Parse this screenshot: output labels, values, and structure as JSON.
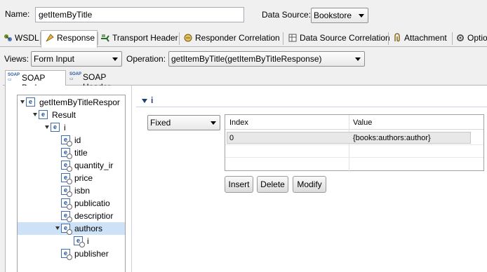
{
  "header": {
    "name_label": "Name:",
    "name_value": "getItemByTitle",
    "datasource_label": "Data Source:",
    "datasource_value": "Bookstore"
  },
  "tabs": [
    {
      "label": "WSDL",
      "icon": "wsdl-icon"
    },
    {
      "label": "Response",
      "icon": "response-icon",
      "active": true
    },
    {
      "label": "Transport Header",
      "icon": "transport-header-icon"
    },
    {
      "label": "Responder Correlation",
      "icon": "responder-correlation-icon"
    },
    {
      "label": "Data Source Correlation",
      "icon": "data-source-correlation-icon"
    },
    {
      "label": "Attachment",
      "icon": "attachment-icon"
    },
    {
      "label": "Optio",
      "icon": "options-icon"
    }
  ],
  "views": {
    "label": "Views:",
    "value": "Form Input",
    "operation_label": "Operation:",
    "operation_value": "getItemByTitle(getItemByTitleResponse)"
  },
  "subtabs": [
    {
      "label": "SOAP Body",
      "icon": "soap-icon",
      "active": true
    },
    {
      "label": "SOAP Header",
      "icon": "soap-icon"
    }
  ],
  "tree": [
    {
      "label": "getItemByTitleRespor",
      "level": 0,
      "expanded": true
    },
    {
      "label": "Result",
      "level": 1,
      "expanded": true
    },
    {
      "label": "i",
      "level": 2,
      "expanded": true
    },
    {
      "label": "id",
      "level": 3
    },
    {
      "label": "title",
      "level": 3
    },
    {
      "label": "quantity_ir",
      "level": 3
    },
    {
      "label": "price",
      "level": 3
    },
    {
      "label": "isbn",
      "level": 3
    },
    {
      "label": "publicatio",
      "level": 3
    },
    {
      "label": "descriptior",
      "level": 3
    },
    {
      "label": "authors",
      "level": 3,
      "expanded": true,
      "selected": true
    },
    {
      "label": "i",
      "level": 4
    },
    {
      "label": "publisher",
      "level": 3
    }
  ],
  "detail": {
    "section_title": "i",
    "mode_value": "Fixed",
    "table": {
      "headers": [
        "Index",
        "Value"
      ],
      "rows": [
        [
          "0",
          "{books:authors:author}"
        ]
      ]
    },
    "buttons": {
      "insert": "Insert",
      "delete": "Delete",
      "modify": "Modify"
    }
  },
  "colors": {
    "selected_row": "#cde1f7",
    "section_title": "#1f3f77",
    "tree_border": "#a0a0a0"
  }
}
